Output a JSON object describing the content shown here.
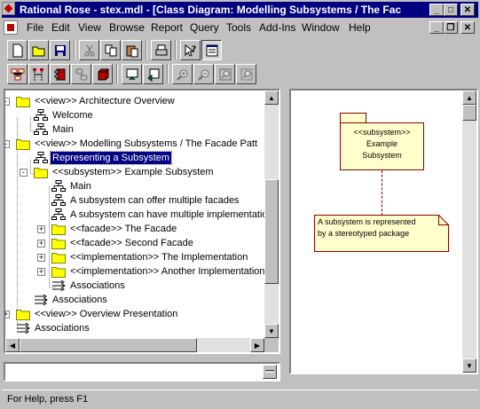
{
  "window": {
    "title": "Rational Rose - stex.mdl - [Class Diagram: Modelling Subsystems / The Facad..."
  },
  "menu": [
    "File",
    "Edit",
    "View",
    "Browse",
    "Report",
    "Query",
    "Tools",
    "Add-Ins",
    "Window",
    "Help"
  ],
  "toolbar1": [
    "new-icon",
    "open-icon",
    "save-icon",
    "cut-icon",
    "copy-icon",
    "paste-icon",
    "print-icon",
    "context-help-icon",
    "browse-window-icon"
  ],
  "toolbar2": [
    "browse-class-diagram-icon",
    "browse-interaction-diagram-icon",
    "browse-component-diagram-icon",
    "browse-state-diagram-icon",
    "browse-deployment-icon",
    "browse-parent-icon",
    "browse-previous-icon",
    "zoom-in-icon",
    "zoom-out-icon",
    "fit-window-icon",
    "undo-fit-icon"
  ],
  "tree": {
    "items": [
      {
        "label": "<<view>> Architecture Overview",
        "icon": "folder"
      },
      {
        "label": "Welcome",
        "icon": "diagram"
      },
      {
        "label": "Main",
        "icon": "diagram"
      },
      {
        "label": "<<view>> Modelling Subsystems / The Facade Patt",
        "icon": "folder"
      },
      {
        "label": "Representing a Subsystem",
        "icon": "diagram"
      },
      {
        "label": "<<subsystem>> Example Subsystem",
        "icon": "folder"
      },
      {
        "label": "Main",
        "icon": "diagram"
      },
      {
        "label": "A subsystem can offer multiple facades",
        "icon": "diagram"
      },
      {
        "label": "A subsystem can have multiple implementatio",
        "icon": "diagram"
      },
      {
        "label": "<<facade>> The Facade",
        "icon": "folder"
      },
      {
        "label": "<<facade>> Second Facade",
        "icon": "folder"
      },
      {
        "label": "<<implementation>> The Implementation",
        "icon": "folder"
      },
      {
        "label": "<<implementation>> Another Implementation",
        "icon": "folder"
      },
      {
        "label": "Associations",
        "icon": "assoc"
      },
      {
        "label": "Associations",
        "icon": "assoc"
      },
      {
        "label": "<<view>> Overview Presentation",
        "icon": "folder"
      },
      {
        "label": "Associations",
        "icon": "assoc"
      }
    ]
  },
  "diagram": {
    "package_stereotype": "<<subsystem>>",
    "package_name_line1": "Example",
    "package_name_line2": "Subsystem",
    "note_line1": "A subsystem is represented",
    "note_line2": "by a stereotyped package"
  },
  "status": {
    "text": "For Help, press F1"
  },
  "colors": {
    "titlebar": "#000080",
    "selection": "#000080",
    "folder": "#ffff00",
    "note": "#ffffcc",
    "package_border": "#8b0000"
  }
}
